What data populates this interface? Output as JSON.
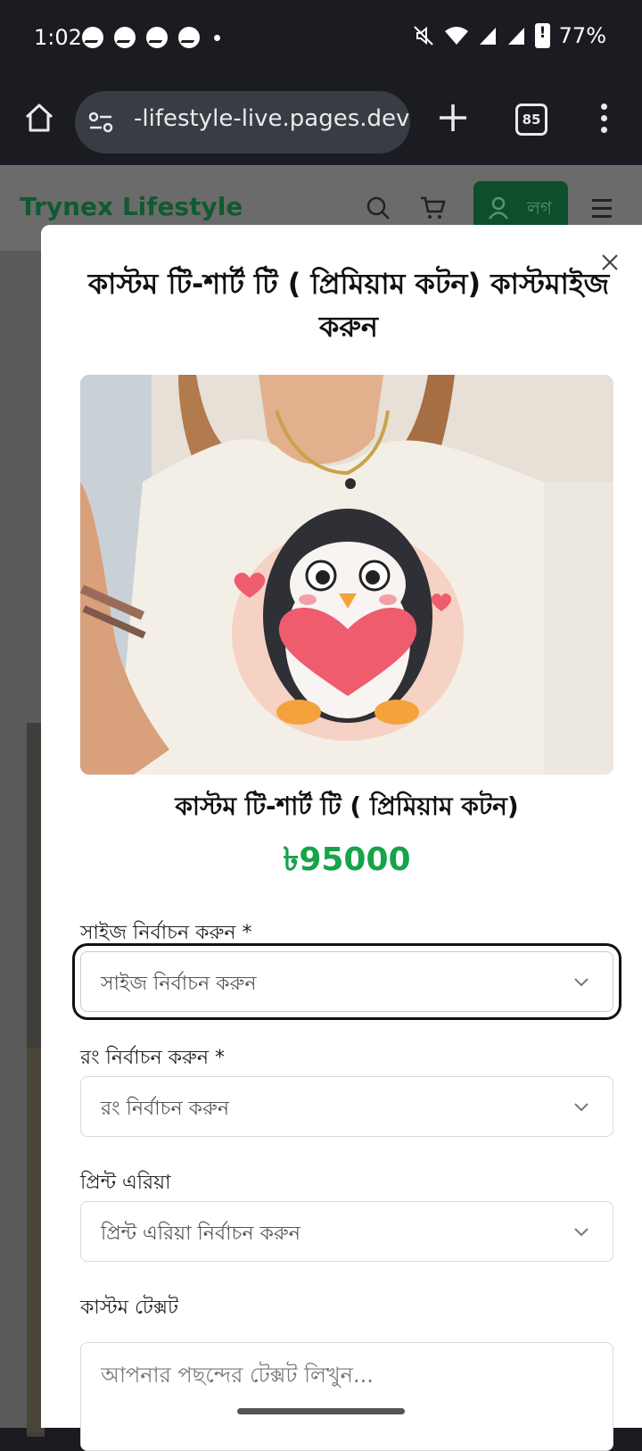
{
  "status_bar": {
    "time": "1:02",
    "battery": "77%"
  },
  "browser": {
    "url": "-lifestyle-live.pages.dev",
    "tab_count": "85"
  },
  "site": {
    "brand": "Trynex Lifestyle",
    "login_label": "লগ"
  },
  "modal": {
    "title": "কাস্টম টি-শার্ট টি ( প্রিমিয়াম কটন) কাস্টমাইজ করুন",
    "product_name": "কাস্টম টি-শার্ট টি ( প্রিমিয়াম কটন)",
    "price": "৳95000",
    "size": {
      "label": "সাইজ নির্বাচন করুন *",
      "placeholder": "সাইজ নির্বাচন করুন"
    },
    "color": {
      "label": "রং নির্বাচন করুন *",
      "placeholder": "রং নির্বাচন করুন"
    },
    "print_area": {
      "label": "প্রিন্ট এরিয়া",
      "placeholder": "প্রিন্ট এরিয়া নির্বাচন করুন"
    },
    "custom_text": {
      "label": "কাস্টম টেক্সট",
      "placeholder": "আপনার পছন্দের টেক্সট লিখুন..."
    }
  },
  "colors": {
    "accent_green": "#16a34a",
    "brand_green": "#0f5a32"
  }
}
